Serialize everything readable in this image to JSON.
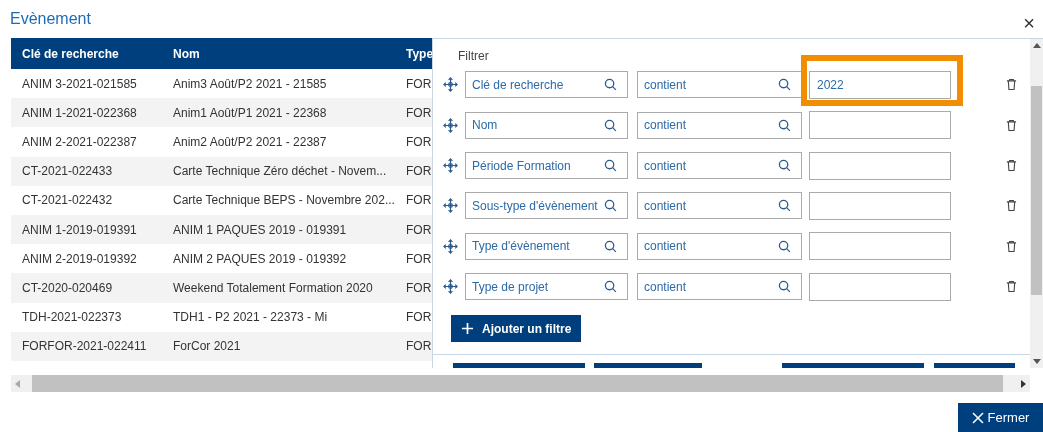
{
  "window": {
    "title": "Evènement",
    "close": "×"
  },
  "table": {
    "columns": [
      "Clé de recherche",
      "Nom",
      "Type"
    ],
    "rows": [
      [
        "ANIM 3-2021-021585",
        "Anim3 Août/P2 2021 - 21585",
        "FOR"
      ],
      [
        "ANIM 1-2021-022368",
        "Anim1 Août/P1 2021 - 22368",
        "FOR"
      ],
      [
        "ANIM 2-2021-022387",
        "Anim2 Août/P2 2021 - 22387",
        "FOR"
      ],
      [
        "CT-2021-022433",
        "Carte Technique Zéro déchet - Novem...",
        "FOR"
      ],
      [
        "CT-2021-022432",
        "Carte Technique BEPS - Novembre 202...",
        "FOR"
      ],
      [
        "ANIM 1-2019-019391",
        "ANIM 1 PAQUES 2019 - 019391",
        "FOR"
      ],
      [
        "ANIM 2-2019-019392",
        "ANIM 2 PAQUES 2019 - 019392",
        "FOR"
      ],
      [
        "CT-2020-020469",
        "Weekend Totalement Formation 2020",
        "FOR"
      ],
      [
        "TDH-2021-022373",
        "TDH1 - P2 2021 - 22373 - Mi",
        "FOR"
      ],
      [
        "FORFOR-2021-022411",
        "ForCor 2021",
        "FOR"
      ]
    ]
  },
  "filter_panel": {
    "title": "Filtrer",
    "filters": [
      {
        "field": "Clé de recherche",
        "operator": "contient",
        "value": "2022",
        "highlighted": true
      },
      {
        "field": "Nom",
        "operator": "contient",
        "highlighted": false
      },
      {
        "field": "Période Formation",
        "operator": "contient",
        "highlighted": false
      },
      {
        "field": "Sous-type d'évènement",
        "operator": "contient",
        "highlighted": false
      },
      {
        "field": "Type d'évènement",
        "operator": "contient",
        "highlighted": false
      },
      {
        "field": "Type de projet",
        "operator": "contient",
        "highlighted": false
      }
    ],
    "add_button": "Ajouter un filtre"
  },
  "close_button": "Fermer"
}
